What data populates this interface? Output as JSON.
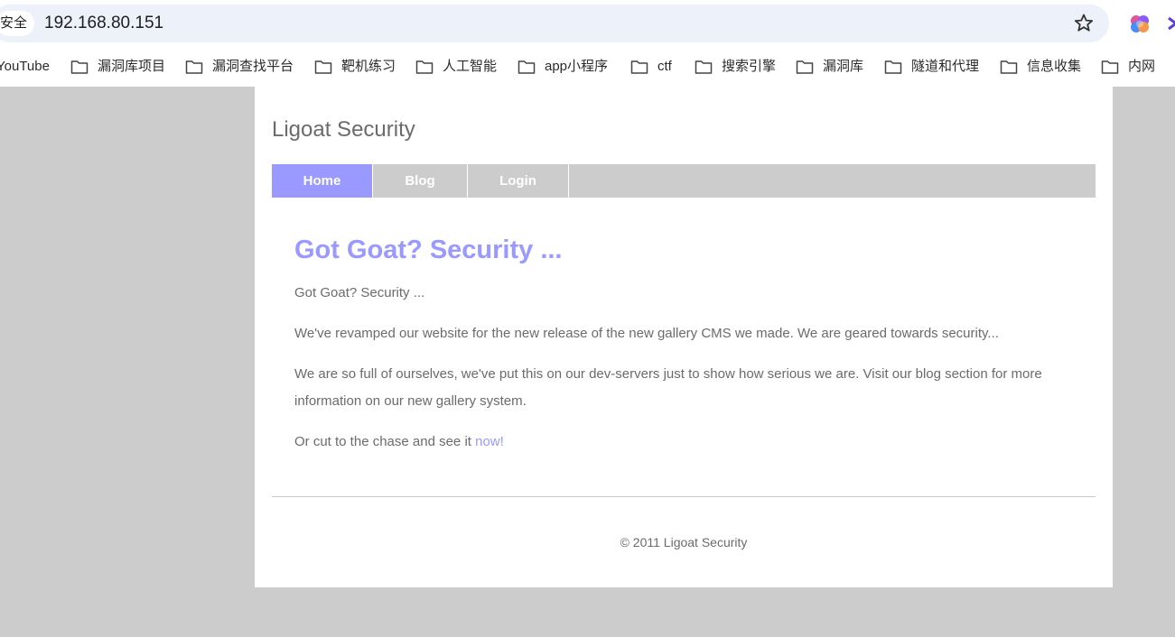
{
  "browser": {
    "secure_label": "安全",
    "url": "192.168.80.151",
    "icons": {
      "star": "bookmark-star-icon",
      "extension": "extension-icon"
    }
  },
  "bookmarks": [
    {
      "label": "YouTube",
      "folder": false
    },
    {
      "label": "漏洞库项目",
      "folder": true
    },
    {
      "label": "漏洞查找平台",
      "folder": true
    },
    {
      "label": "靶机练习",
      "folder": true
    },
    {
      "label": "人工智能",
      "folder": true
    },
    {
      "label": "app小程序",
      "folder": true
    },
    {
      "label": "ctf",
      "folder": true
    },
    {
      "label": "搜索引擎",
      "folder": true
    },
    {
      "label": "漏洞库",
      "folder": true
    },
    {
      "label": "隧道和代理",
      "folder": true
    },
    {
      "label": "信息收集",
      "folder": true
    },
    {
      "label": "内网",
      "folder": true
    }
  ],
  "site": {
    "title": "Ligoat Security",
    "nav": [
      {
        "label": "Home",
        "active": true
      },
      {
        "label": "Blog",
        "active": false
      },
      {
        "label": "Login",
        "active": false
      }
    ],
    "headline": "Got Goat? Security ...",
    "paragraphs": [
      "Got Goat? Security ...",
      "We've revamped our website for the new release of the new gallery CMS we made. We are geared towards security...",
      "We are so full of ourselves, we've put this on our dev-servers just to show how serious we are. Visit our blog section for more information on our new gallery system."
    ],
    "cta_text": "Or cut to the chase and see it ",
    "cta_link": "now!",
    "footer": "© 2011 Ligoat Security"
  },
  "colors": {
    "accent": "#9999ff",
    "nav_bg": "#cccccc",
    "page_bg": "#cccccc",
    "text": "#6b6b6b"
  }
}
